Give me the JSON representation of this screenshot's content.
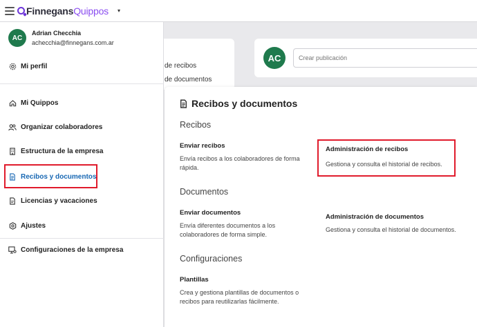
{
  "app": {
    "logo_part1": "Finnegans",
    "logo_part2": "Quippos",
    "caret": "▾"
  },
  "user": {
    "initials": "AC",
    "name": "Adrian Checchia",
    "email": "achecchia@finnegans.com.ar"
  },
  "sidebar": {
    "profile": {
      "label": "Mi perfil",
      "icon": "gear-icon"
    },
    "items": [
      {
        "label": "Mi Quippos",
        "icon": "home-icon"
      },
      {
        "label": "Organizar colaboradores",
        "icon": "users-icon"
      },
      {
        "label": "Estructura de la empresa",
        "icon": "building-icon"
      },
      {
        "label": "Recibos y documentos",
        "icon": "document-icon",
        "active": true
      },
      {
        "label": "Licencias y vacaciones",
        "icon": "calendar-icon"
      },
      {
        "label": "Ajustes",
        "icon": "settings-icon"
      },
      {
        "label": "Configuraciones de la empresa",
        "icon": "monitor-gear-icon"
      }
    ]
  },
  "background": {
    "left_card_lines": [
      "de recibos",
      "de documentos"
    ],
    "post_avatar": "AC",
    "post_placeholder": "Crear publicación"
  },
  "panel": {
    "title": "Recibos y documentos",
    "sections": [
      {
        "name": "Recibos",
        "entries": [
          {
            "title": "Enviar recibos",
            "desc": "Envía recibos a los colaboradores de forma rápida."
          },
          {
            "title": "Administración de recibos",
            "desc": "Gestiona y consulta el historial de recibos."
          }
        ]
      },
      {
        "name": "Documentos",
        "entries": [
          {
            "title": "Enviar documentos",
            "desc": "Envía diferentes documentos a los colaboradores de forma simple."
          },
          {
            "title": "Administración de documentos",
            "desc": "Gestiona y consulta el historial de documentos."
          }
        ]
      },
      {
        "name": "Configuraciones",
        "entries": [
          {
            "title": "Plantillas",
            "desc": "Crea y gestiona plantillas de documentos o recibos para reutilizarlas fácilmente."
          }
        ]
      }
    ]
  },
  "colors": {
    "brand": "#6c35d8",
    "active": "#1767b3",
    "avatar": "#1f7a4d",
    "highlight": "#e01a2b"
  }
}
